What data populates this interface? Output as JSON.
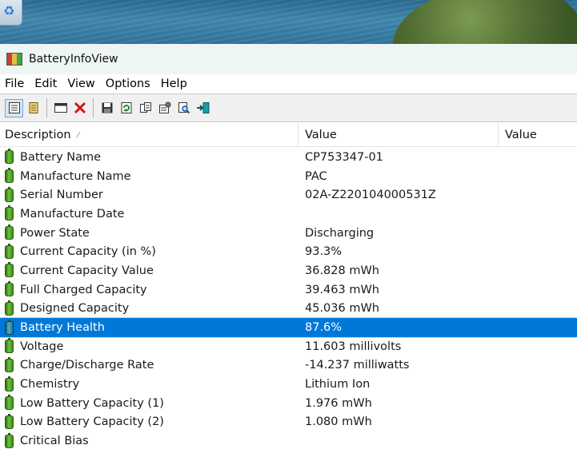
{
  "window": {
    "title": "BatteryInfoView"
  },
  "menu": [
    "File",
    "Edit",
    "View",
    "Options",
    "Help"
  ],
  "toolbar": {
    "buttons": [
      {
        "name": "properties-view-button",
        "icon": "list-view-icon",
        "pressed": true
      },
      {
        "name": "log-view-button",
        "icon": "log-list-icon",
        "pressed": false
      },
      {
        "name": "window-button",
        "icon": "window-icon",
        "pressed": false
      },
      {
        "name": "clear-button",
        "icon": "red-x-icon",
        "pressed": false
      },
      {
        "name": "save-button",
        "icon": "floppy-disk-icon",
        "pressed": false
      },
      {
        "name": "refresh-button",
        "icon": "refresh-icon",
        "pressed": false
      },
      {
        "name": "copy-button",
        "icon": "copy-icon",
        "pressed": false
      },
      {
        "name": "properties-button",
        "icon": "properties-icon",
        "pressed": false
      },
      {
        "name": "find-button",
        "icon": "find-icon",
        "pressed": false
      },
      {
        "name": "exit-button",
        "icon": "exit-icon",
        "pressed": false
      }
    ]
  },
  "columns": [
    "Description",
    "Value",
    "Value"
  ],
  "rows": [
    {
      "desc": "Battery Name",
      "value": "CP753347-01"
    },
    {
      "desc": "Manufacture Name",
      "value": "PAC"
    },
    {
      "desc": "Serial Number",
      "value": "02A-Z220104000531Z"
    },
    {
      "desc": "Manufacture Date",
      "value": ""
    },
    {
      "desc": "Power State",
      "value": "Discharging"
    },
    {
      "desc": "Current Capacity (in %)",
      "value": "93.3%"
    },
    {
      "desc": "Current Capacity Value",
      "value": "36.828 mWh"
    },
    {
      "desc": "Full Charged Capacity",
      "value": "39.463 mWh"
    },
    {
      "desc": "Designed Capacity",
      "value": "45.036 mWh"
    },
    {
      "desc": "Battery Health",
      "value": "87.6%",
      "selected": true
    },
    {
      "desc": "Voltage",
      "value": "11.603 millivolts"
    },
    {
      "desc": "Charge/Discharge Rate",
      "value": "-14.237 milliwatts"
    },
    {
      "desc": "Chemistry",
      "value": "Lithium Ion"
    },
    {
      "desc": "Low Battery Capacity (1)",
      "value": "1.976 mWh"
    },
    {
      "desc": "Low Battery Capacity (2)",
      "value": "1.080 mWh"
    },
    {
      "desc": "Critical Bias",
      "value": ""
    }
  ],
  "colors": {
    "selection": "#0078d7",
    "titlebar": "#eef6f3",
    "battery_green": "#6cc33a"
  }
}
